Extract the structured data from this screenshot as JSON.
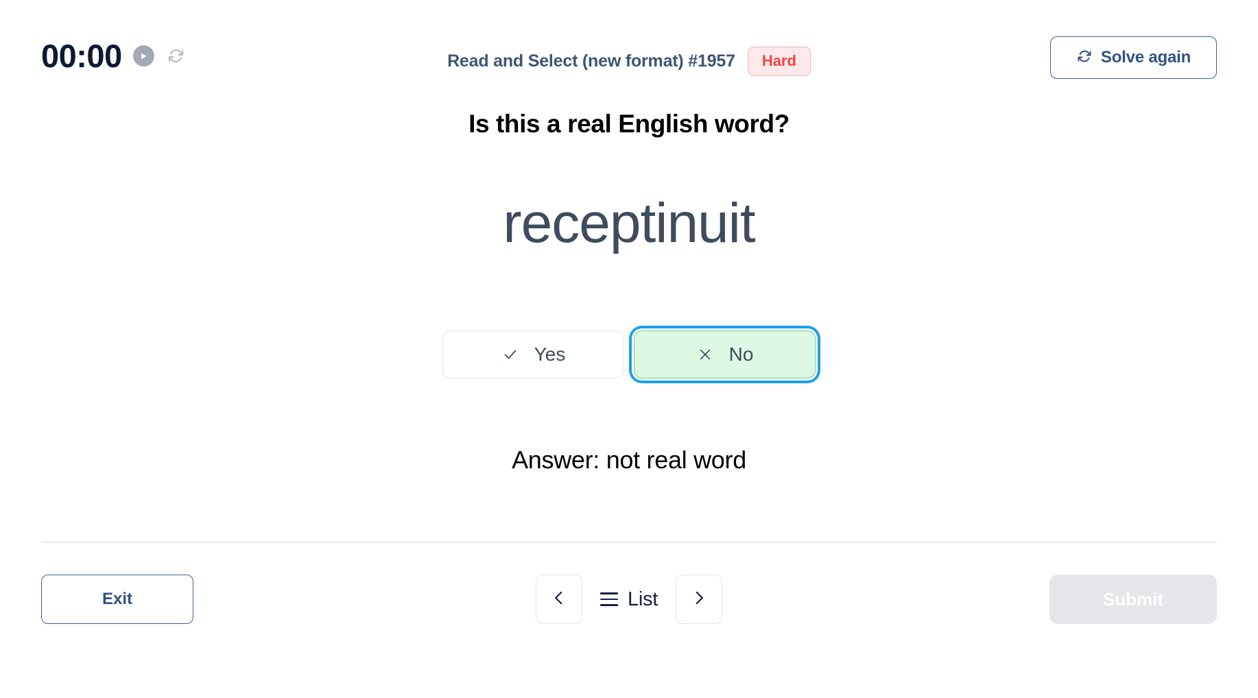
{
  "header": {
    "timer": "00:00",
    "play_icon": "play-icon",
    "reset_icon": "reset-icon",
    "title": "Read and Select (new format) #1957",
    "difficulty_badge": "Hard",
    "solve_again_label": "Solve again",
    "solve_again_icon": "refresh-icon"
  },
  "question": {
    "prompt": "Is this a real English word?",
    "word": "receptinuit"
  },
  "choices": [
    {
      "label": "Yes",
      "icon": "check-icon",
      "selected": false
    },
    {
      "label": "No",
      "icon": "cross-icon",
      "selected": true
    }
  ],
  "answer": {
    "text": "Answer: not real word"
  },
  "footer": {
    "exit_label": "Exit",
    "prev_icon": "chevron-left-icon",
    "list_label": "List",
    "list_icon": "hamburger-icon",
    "next_icon": "chevron-right-icon",
    "submit_label": "Submit"
  },
  "colors": {
    "timer_text": "#0b1b32",
    "title_text": "#3f5673",
    "badge_hard_text": "#ef4444",
    "badge_hard_bg": "#fde9e9",
    "accent_blue": "#335280",
    "focus_ring": "#1aa0f0",
    "selected_bg": "#ddf8e3",
    "selected_border": "#6fd187",
    "word_text": "#3e4c5c",
    "submit_disabled_bg": "#e4e6ea"
  }
}
